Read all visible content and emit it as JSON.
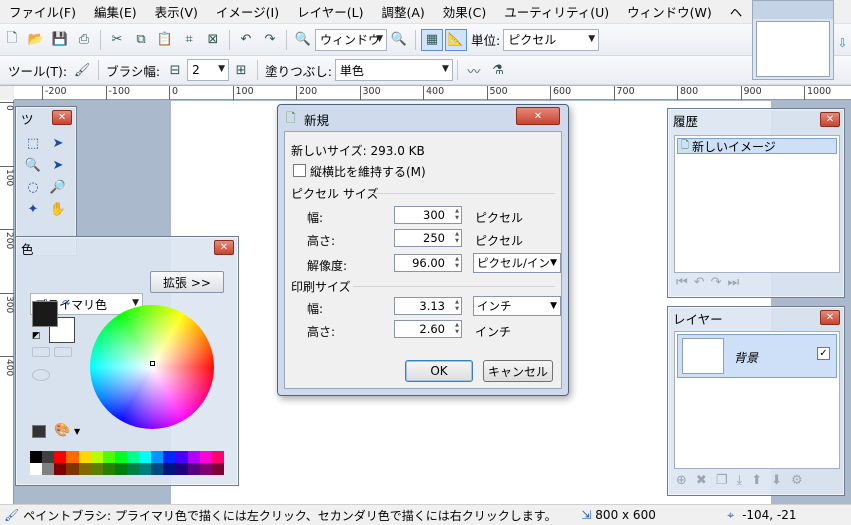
{
  "menu": [
    "ファイル(F)",
    "編集(E)",
    "表示(V)",
    "イメージ(I)",
    "レイヤー(L)",
    "調整(A)",
    "効果(C)",
    "ユーティリティ(U)",
    "ウィンドウ(W)",
    "ヘ"
  ],
  "toolbar1": {
    "zoom_value": "ウィンドウ",
    "unit_label": "単位:",
    "unit_value": "ピクセル"
  },
  "toolbar2": {
    "tool_label": "ツール(T):",
    "brush_label": "ブラシ幅:",
    "brush_value": "2",
    "fill_label": "塗りつぶし:",
    "fill_value": "単色"
  },
  "rulers": {
    "h_ticks": [
      "-200",
      "-100",
      "0",
      "100",
      "200",
      "300",
      "400",
      "500",
      "600",
      "700",
      "800",
      "900",
      "1000"
    ],
    "v_ticks": [
      "0",
      "100",
      "200",
      "300",
      "400"
    ]
  },
  "tools_window": {
    "title": "ツ"
  },
  "colors_window": {
    "title": "色",
    "primary_select": "プライマリ色",
    "expand_button": "拡張 >>",
    "palette_colors": [
      "#000000",
      "#404040",
      "#ff0000",
      "#ff6a00",
      "#ffd800",
      "#b6ff00",
      "#4cff00",
      "#00ff21",
      "#00ff90",
      "#00ffff",
      "#0094ff",
      "#0026ff",
      "#4800ff",
      "#b200ff",
      "#ff00dc",
      "#ff006e",
      "#ffffff",
      "#808080",
      "#7f0000",
      "#7f3300",
      "#7f6a00",
      "#5b7f00",
      "#267f00",
      "#007f0e",
      "#007f46",
      "#007f7f",
      "#004a7f",
      "#00137f",
      "#21007f",
      "#57007f",
      "#7f006e",
      "#7f0037"
    ]
  },
  "history_window": {
    "title": "履歴",
    "items": [
      "新しいイメージ"
    ]
  },
  "layers_window": {
    "title": "レイヤー",
    "layers": [
      {
        "name": "背景",
        "visible": true
      }
    ]
  },
  "dialog": {
    "title": "新規",
    "new_size": "新しいサイズ: 293.0 KB",
    "keep_ratio": "縦横比を維持する(M)",
    "pixel_size_header": "ピクセル サイズ",
    "width_label": "幅:",
    "width_value": "300",
    "width_unit": "ピクセル",
    "height_label": "高さ:",
    "height_value": "250",
    "height_unit": "ピクセル",
    "resolution_label": "解像度:",
    "resolution_value": "96.00",
    "resolution_unit": "ピクセル/インチ",
    "print_size_header": "印刷サイズ",
    "print_width_label": "幅:",
    "print_width_value": "3.13",
    "print_width_unit": "インチ",
    "print_height_label": "高さ:",
    "print_height_value": "2.60",
    "print_height_unit": "インチ",
    "ok": "OK",
    "cancel": "キャンセル"
  },
  "status": {
    "message": "ペイントブラシ: プライマリ色で描くには左クリック、セカンダリ色で描くには右クリックします。",
    "image_size": "800 x 600",
    "cursor_pos": "-104, -21"
  }
}
